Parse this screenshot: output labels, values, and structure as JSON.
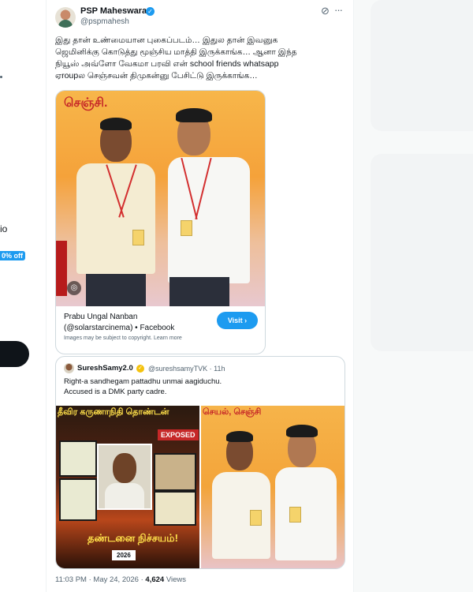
{
  "sidebar": {
    "partial_label": "io",
    "partial_badge": "0% off"
  },
  "tweet": {
    "display_name": "PSP Maheswaran",
    "handle": "@pspmahesh",
    "text": "இது தான் உண்மையான புகைப்படம்… இதுல தான் இவனுக\nஜெமினிக்கு கொடுத்து மூஞ்சிய மாத்தி இருக்காங்க… ஆனா இந்த\nநியூஸ் அவ்ளோ வேகமா பரவி என் school friends whatsapp\nஏroupல செஞ்சவன் திமுகன்னு பேசிட்டு இருக்காங்க…",
    "timestamp": "11:03 PM · May 24, 2026",
    "views_count": "4,624",
    "views_label": "Views"
  },
  "link_card": {
    "photo_banner": "செஞ்சி.",
    "title": "Prabu Ungal Nanban",
    "source": "(@solarstarcinema) • Facebook",
    "copyright_note": "Images may be subject to copyright. Learn more",
    "visit_label": "Visit"
  },
  "quote": {
    "display_name": "SureshSamy2.0",
    "handle": "@sureshsamyTVK",
    "time": "· 11h",
    "text": "Right-a sandhegam pattadhu unmai aagiduchu.\nAccused is a DMK party cadre.",
    "poster_title": "தீவிர கருணாநிதி தொண்டன்",
    "poster_exposed": "EXPOSED",
    "poster_bottom": "தண்டனை நிச்சயம்!",
    "poster_year": "2026",
    "right_banner": "செயல், செஞ்சி"
  },
  "colors": {
    "accent": "#1d9bf0",
    "text": "#0f1419",
    "secondary_text": "#536471"
  }
}
